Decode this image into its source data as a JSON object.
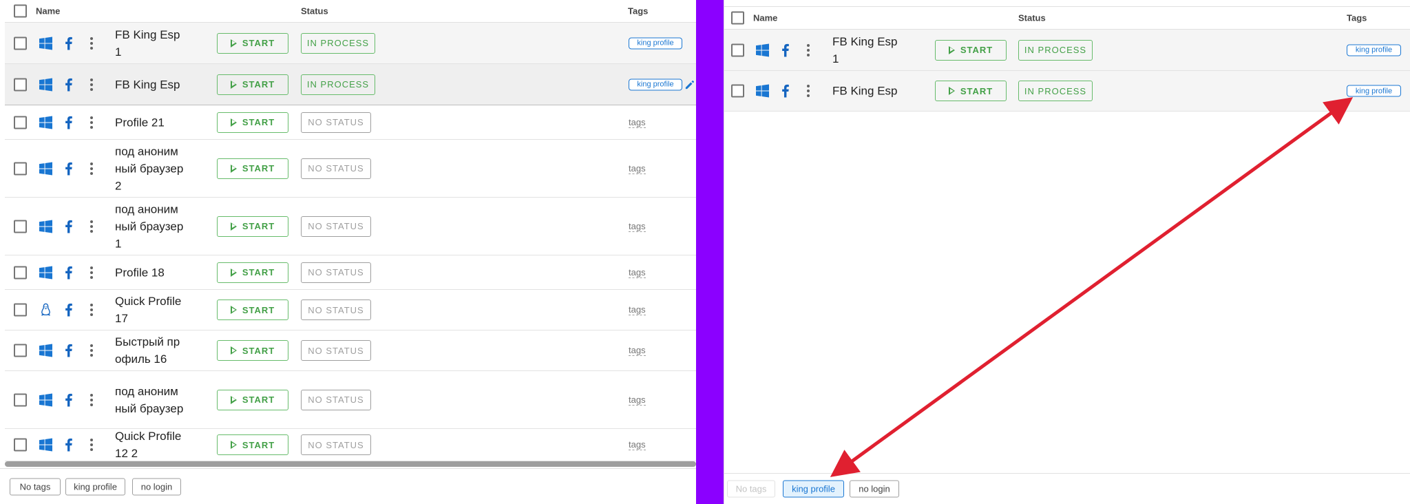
{
  "left": {
    "header": {
      "name": "Name",
      "status": "Status",
      "tags": "Tags"
    },
    "rows": [
      {
        "os": "windows",
        "name": "FB King Esp 1",
        "start": "START",
        "status": "IN PROCESS",
        "tag": "king profile"
      },
      {
        "os": "windows",
        "name": "FB King Esp",
        "start": "START",
        "status": "IN PROCESS",
        "tag": "king profile"
      },
      {
        "os": "windows",
        "name": "Profile 21",
        "start": "START",
        "status": "NO STATUS",
        "tag": "tags"
      },
      {
        "os": "windows",
        "name": "под анонимный браузер 2",
        "start": "START",
        "status": "NO STATUS",
        "tag": "tags"
      },
      {
        "os": "windows",
        "name": "под анонимный браузер 1",
        "start": "START",
        "status": "NO STATUS",
        "tag": "tags"
      },
      {
        "os": "windows",
        "name": "Profile 18",
        "start": "START",
        "status": "NO STATUS",
        "tag": "tags"
      },
      {
        "os": "linux",
        "name": "Quick Profile 17",
        "start": "START",
        "status": "NO STATUS",
        "tag": "tags"
      },
      {
        "os": "windows",
        "name": "Быстрый профиль 16",
        "start": "START",
        "status": "NO STATUS",
        "tag": "tags"
      },
      {
        "os": "windows",
        "name": "под анонимный браузер",
        "start": "START",
        "status": "NO STATUS",
        "tag": "tags"
      },
      {
        "os": "windows",
        "name": "Quick Profile 12 2",
        "start": "START",
        "status": "NO STATUS",
        "tag": "tags"
      }
    ],
    "filters": [
      "No tags",
      "king profile",
      "no login"
    ]
  },
  "right": {
    "header": {
      "name": "Name",
      "status": "Status",
      "tags": "Tags"
    },
    "rows": [
      {
        "os": "windows",
        "name": "FB King Esp 1",
        "start": "START",
        "status": "IN PROCESS",
        "tag": "king profile"
      },
      {
        "os": "windows",
        "name": "FB King Esp",
        "start": "START",
        "status": "IN PROCESS",
        "tag": "king profile"
      }
    ],
    "filters": [
      "No tags",
      "king profile",
      "no login"
    ]
  },
  "colors": {
    "divider": "#8b00ff",
    "annotation_arrow": "#e02030",
    "accent_green": "#43a047",
    "accent_blue": "#1976d2"
  },
  "icons": [
    "windows-icon",
    "linux-icon",
    "facebook-icon",
    "kebab-menu-icon",
    "play-icon",
    "pencil-icon"
  ]
}
